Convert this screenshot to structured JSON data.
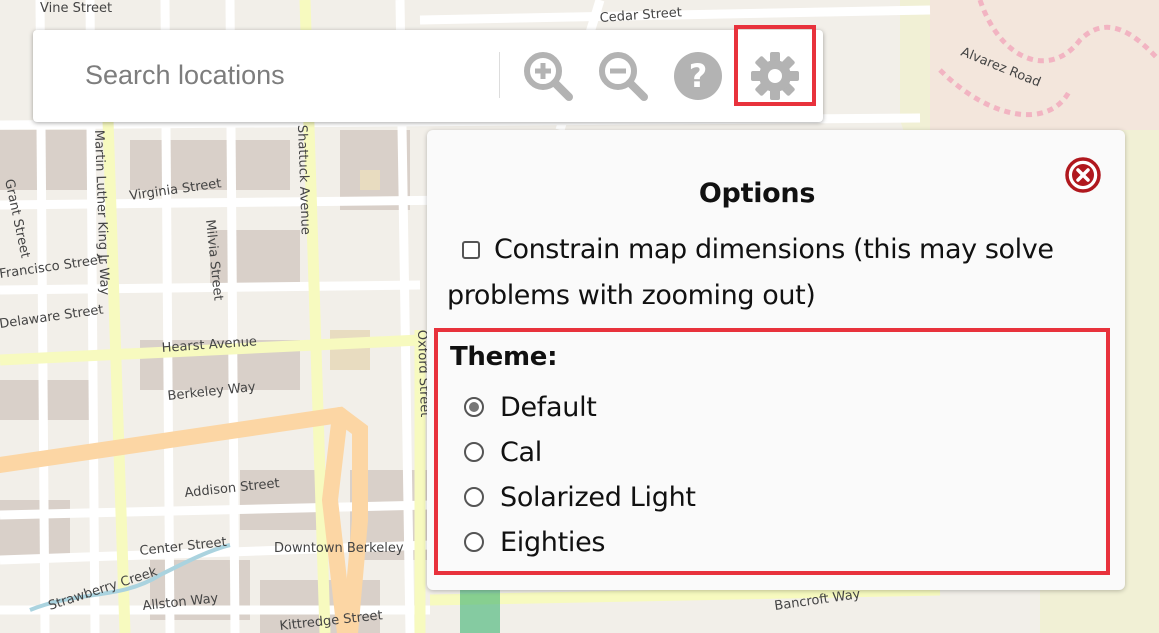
{
  "map": {
    "street_labels": [
      "Vine Street",
      "Cedar Street",
      "Alvarez Road",
      "Virginia Street",
      "Martin Luther King Jr Way",
      "Grant Street",
      "Francisco Street",
      "Delaware Street",
      "Hearst Avenue",
      "Berkeley Way",
      "Milvia Street",
      "Addison Street",
      "Center Street",
      "Downtown Berkeley",
      "Allston Way",
      "Strawberry Creek",
      "Kittredge Street",
      "Bancroft Way",
      "Oxford Street",
      "Shattuck Avenue"
    ]
  },
  "toolbar": {
    "search_placeholder": "Search locations",
    "buttons": [
      {
        "icon": "zoom-in-icon",
        "label": "Zoom in"
      },
      {
        "icon": "zoom-out-icon",
        "label": "Zoom out"
      },
      {
        "icon": "help-icon",
        "label": "Help"
      },
      {
        "icon": "gear-icon",
        "label": "Settings"
      }
    ]
  },
  "options": {
    "title": "Options",
    "constrain": {
      "label": "Constrain map dimensions (this may solve problems with zooming out)",
      "checked": false
    },
    "theme": {
      "label": "Theme:",
      "options": [
        "Default",
        "Cal",
        "Solarized Light",
        "Eighties"
      ],
      "selected": "Default"
    }
  },
  "colors": {
    "highlight": "#e8323c",
    "close_icon": "#b0181e",
    "toolbar_icon": "#b3b3b3"
  }
}
